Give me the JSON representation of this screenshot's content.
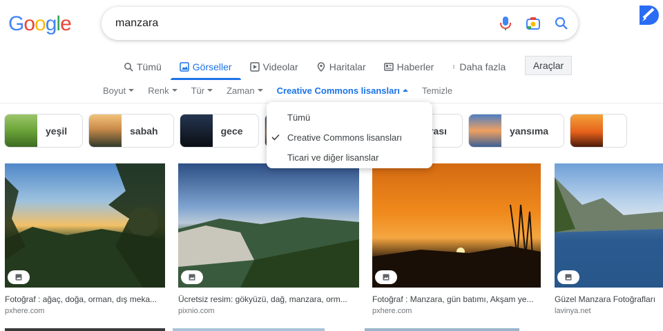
{
  "logo": "Google",
  "search": {
    "query": "manzara"
  },
  "tabs": [
    {
      "label": "Tümü",
      "icon": "search-icon"
    },
    {
      "label": "Görseller",
      "icon": "image-icon",
      "active": true
    },
    {
      "label": "Videolar",
      "icon": "video-icon"
    },
    {
      "label": "Haritalar",
      "icon": "map-pin-icon"
    },
    {
      "label": "Haberler",
      "icon": "news-icon"
    },
    {
      "label": "Daha fazla",
      "icon": "more-vert-icon"
    }
  ],
  "tools_label": "Araçlar",
  "filters": [
    {
      "label": "Boyut"
    },
    {
      "label": "Renk"
    },
    {
      "label": "Tür"
    },
    {
      "label": "Zaman"
    },
    {
      "label": "Creative Commons lisansları",
      "active": true
    },
    {
      "label": "Temizle"
    }
  ],
  "dropdown": {
    "items": [
      {
        "label": "Tümü",
        "checked": false
      },
      {
        "label": "Creative Commons lisansları",
        "checked": true
      },
      {
        "label": "Ticari ve diğer lisanslar",
        "checked": false
      }
    ]
  },
  "chips": [
    {
      "label": "yeşil",
      "colors": [
        "#6fa83b",
        "#4a7a2a"
      ]
    },
    {
      "label": "sabah",
      "colors": [
        "#e2a65a",
        "#3d4f3a"
      ]
    },
    {
      "label": "gece",
      "colors": [
        "#1c2b3d",
        "#0b0f18"
      ]
    },
    {
      "label": "",
      "colors": [
        "#37527a",
        "#c88a4a"
      ]
    },
    {
      "label": "manzarası",
      "colors": [
        "#d6a26b",
        "#5a6f88"
      ]
    },
    {
      "label": "yansıma",
      "colors": [
        "#4e7fc2",
        "#f0a060"
      ]
    },
    {
      "label": "",
      "colors": [
        "#f07a1a",
        "#d13f0e"
      ]
    }
  ],
  "results": [
    {
      "title": "Fotoğraf : ağaç, doğa, orman, dış meka...",
      "source": "pxhere.com"
    },
    {
      "title": "Ücretsiz resim: gökyüzü, dağ, manzara, orm...",
      "source": "pixnio.com"
    },
    {
      "title": "Fotoğraf : Manzara, gün batımı, Akşam ye...",
      "source": "pxhere.com"
    },
    {
      "title": "Güzel Manzara Fotoğrafları",
      "source": "lavinya.net"
    }
  ],
  "colors": {
    "accent": "#1a73e8"
  }
}
